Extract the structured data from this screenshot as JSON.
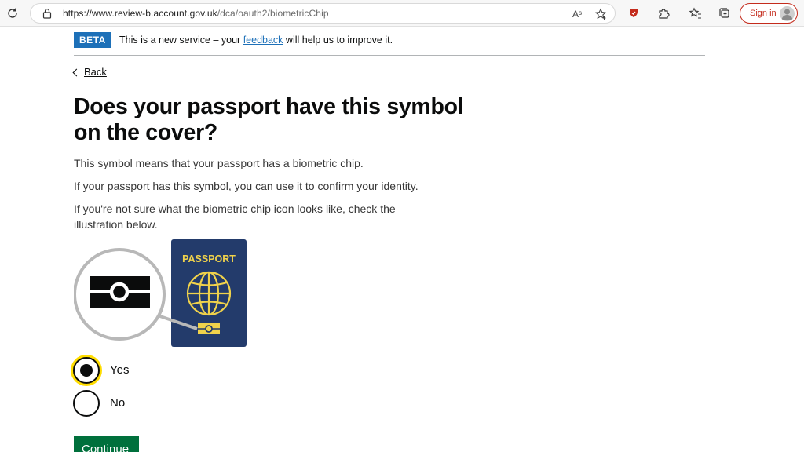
{
  "browser": {
    "url_host": "https://www.review-b.account.gov.uk",
    "url_path": "/dca/oauth2/biometricChip",
    "read_aloud_icon": "Aˢ",
    "signin_label": "Sign in"
  },
  "phase_banner": {
    "tag": "BETA",
    "text_before": "This is a new service – your ",
    "link": "feedback",
    "text_after": " will help us to improve it."
  },
  "back_link": "Back",
  "heading": "Does your passport have this symbol on the cover?",
  "paragraphs": [
    "This symbol means that your passport has a biometric chip.",
    "If your passport has this symbol, you can use it to confirm your identity.",
    "If you're not sure what the biometric chip icon looks like, check the illustration below."
  ],
  "illustration": {
    "passport_text": "PASSPORT",
    "cover_color": "#233b6b",
    "gold_color": "#f0d24b"
  },
  "radios": [
    {
      "label": "Yes",
      "selected": true
    },
    {
      "label": "No",
      "selected": false
    }
  ],
  "continue_label": "Continue"
}
